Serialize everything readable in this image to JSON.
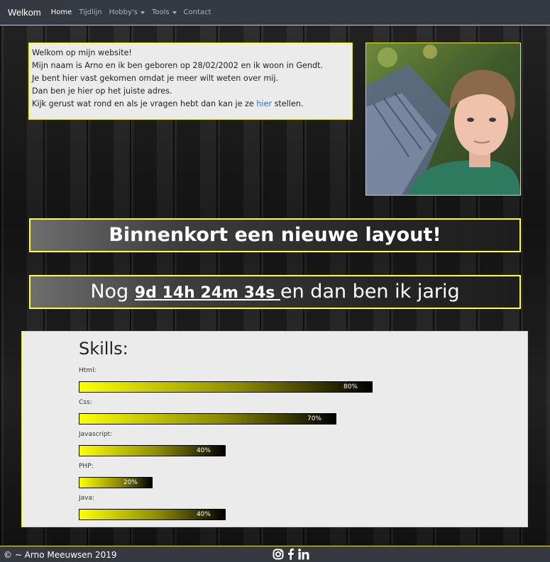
{
  "navbar": {
    "brand": "Welkom",
    "links": [
      {
        "label": "Home"
      },
      {
        "label": "Tijdlijn"
      },
      {
        "label": "Hobby's"
      },
      {
        "label": "Tools"
      },
      {
        "label": "Contact"
      }
    ]
  },
  "intro": {
    "line1": "Welkom op mijn website!",
    "line2": "Mijn naam is Arno en ik ben geboren op 28/02/2002 en ik woon in Gendt.",
    "line3": "Je bent hier vast gekomen omdat je meer wilt weten over mij.",
    "line4": "Dan ben je hier op het juiste adres.",
    "line5_before": "Kijk gerust wat rond en als je vragen hebt dan kan je ze ",
    "line5_link": "hier",
    "line5_after": " stellen."
  },
  "banner1": "Binnenkort een nieuwe layout!",
  "countdown": {
    "prefix": "Nog ",
    "value": "9d 14h 24m 34s ",
    "suffix": "en dan ben ik jarig"
  },
  "skills": {
    "title": "Skills:",
    "items": [
      {
        "label": "Html:",
        "percent": 80,
        "percent_text": "80%"
      },
      {
        "label": "Css:",
        "percent": 70,
        "percent_text": "70%"
      },
      {
        "label": "Javascript:",
        "percent": 40,
        "percent_text": "40%"
      },
      {
        "label": "PHP:",
        "percent": 20,
        "percent_text": "20%"
      },
      {
        "label": "Java:",
        "percent": 40,
        "percent_text": "40%"
      }
    ]
  },
  "footer": {
    "copyright": "© ~ Arno Meeuwsen 2019"
  },
  "colors": {
    "accent": "#e6e619",
    "navbar_bg": "#343a40",
    "link": "#1f73d6"
  },
  "icons": [
    "instagram-icon",
    "facebook-icon",
    "linkedin-icon"
  ]
}
